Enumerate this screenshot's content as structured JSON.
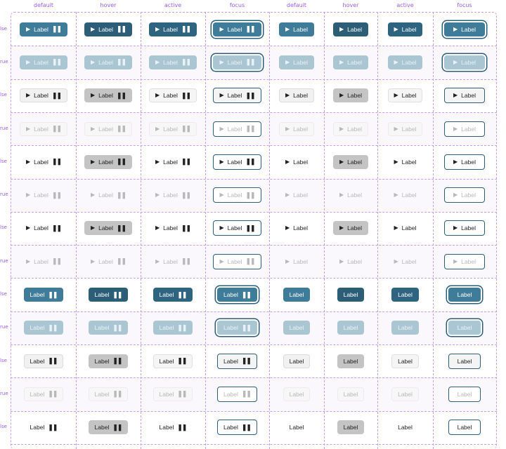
{
  "columns": [
    "default",
    "hover",
    "active",
    "focus",
    "default",
    "hover",
    "active",
    "focus"
  ],
  "row_labels": [
    "lse",
    "rue",
    "lse",
    "rue",
    "lse",
    "rue",
    "lse",
    "rue",
    "lse",
    "rue",
    "lse",
    "rue",
    "lse"
  ],
  "button_label": "Label",
  "play_glyph": "▶",
  "pause_glyph": "❚❚",
  "colors": {
    "primary": "#3f7c99",
    "primary_hover": "#2c5e78",
    "primary_disabled": "#abc6d3",
    "annotation": "#9b5de5"
  }
}
